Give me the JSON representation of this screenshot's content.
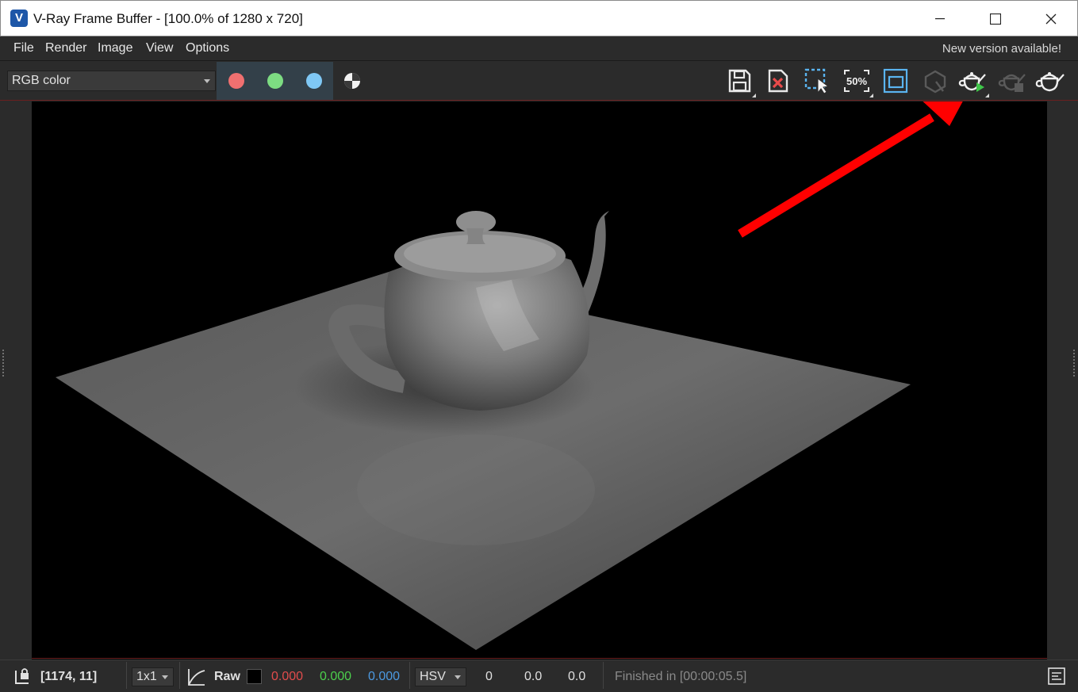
{
  "window": {
    "title": "V-Ray Frame Buffer - [100.0% of 1280 x 720]",
    "app_icon_letter": "V"
  },
  "menu": {
    "items": [
      {
        "label": "File"
      },
      {
        "label": "Render"
      },
      {
        "label": "Image"
      },
      {
        "label": "View"
      },
      {
        "label": "Options"
      }
    ],
    "notice": "New version available!"
  },
  "toolbar": {
    "channel": "RGB color",
    "colors": {
      "red": "#f07070",
      "green": "#7ddc82",
      "blue": "#7fc8f5"
    },
    "zoom_label": "50%",
    "icons": [
      "save-icon",
      "clear-image-icon",
      "region-render-icon",
      "zoom-50-icon",
      "fit-icon",
      "render-interactive-icon",
      "render-last-icon",
      "stop-render-icon",
      "render-icon"
    ]
  },
  "status": {
    "coords": "[1174, 11]",
    "sample_size": "1x1",
    "raw_label": "Raw",
    "r": "0.000",
    "g": "0.000",
    "b": "0.000",
    "color_mode": "HSV",
    "h": "0",
    "s": "0.0",
    "v": "0.0",
    "message": "Finished in [00:00:05.5]",
    "colors": {
      "r": "#e24c4c",
      "g": "#4cd04c",
      "b": "#4c9ae2",
      "message": "#8a8a8a"
    }
  },
  "annotation": {
    "arrow_color": "#ff0000"
  }
}
